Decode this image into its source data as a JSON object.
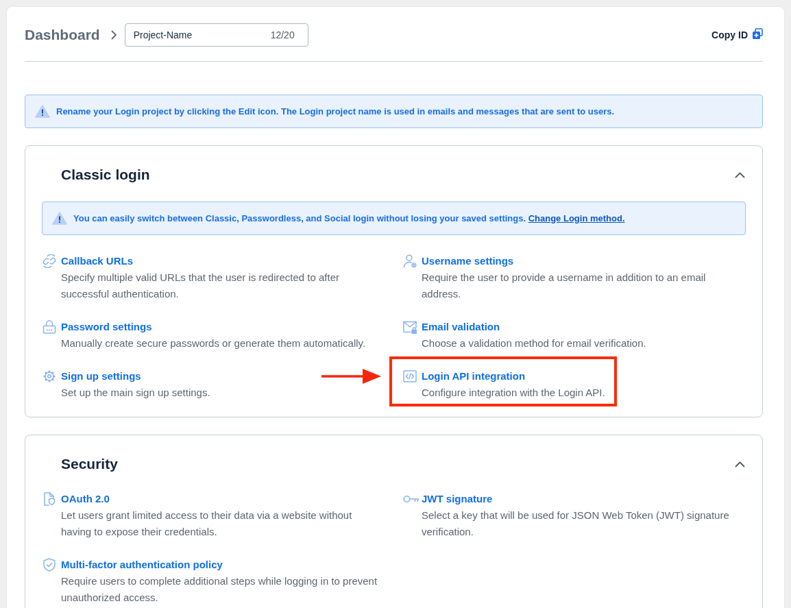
{
  "header": {
    "breadcrumb": "Dashboard",
    "project_name": {
      "value": "Project-Name",
      "counter": "12/20"
    },
    "copy_button": "Copy ID"
  },
  "notice": "Rename your Login project by clicking the Edit icon. The Login project name is used in emails and messages that are sent to users.",
  "sections": [
    {
      "title": "Classic login",
      "expanded": true,
      "notice": {
        "text": "You can easily switch between Classic, Passwordless, and Social login without losing your saved settings.",
        "link": "Change Login method."
      },
      "items": [
        {
          "kind": "callbacks",
          "title": "Callback URLs",
          "description": "Specify multiple valid URLs that the user is redirected to after successful authentication.",
          "highlighted": false
        },
        {
          "kind": "username",
          "title": "Username settings",
          "description": "Require the user to provide a username in addition to an email address.",
          "highlighted": false
        },
        {
          "kind": "password",
          "title": "Password settings",
          "description": "Manually create secure passwords or generate them automatically.",
          "highlighted": false
        },
        {
          "kind": "email",
          "title": "Email validation",
          "description": "Choose a validation method for email verification.",
          "highlighted": false
        },
        {
          "kind": "signup",
          "title": "Sign up settings",
          "description": "Set up the main sign up settings.",
          "highlighted": false
        },
        {
          "kind": "api",
          "title": "Login API integration",
          "description": "Configure integration with the Login API.",
          "highlighted": true
        }
      ]
    },
    {
      "title": "Security",
      "expanded": true,
      "items": [
        {
          "kind": "oauth",
          "title": "OAuth 2.0",
          "description": "Let users grant limited access to their data via a website without having to expose their credentials.",
          "highlighted": false
        },
        {
          "kind": "jwt",
          "title": "JWT signature",
          "description": "Select a key that will be used for JSON Web Token (JWT) signature verification.",
          "highlighted": false
        },
        {
          "kind": "mfa",
          "title": "Multi-factor authentication policy",
          "description": "Require users to complete additional steps while logging in to prevent unauthorized access.",
          "highlighted": false
        }
      ]
    }
  ]
}
